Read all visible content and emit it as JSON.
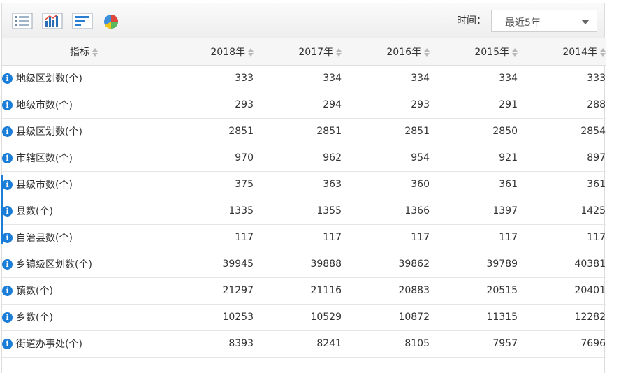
{
  "toolbar": {
    "icons": [
      "table-view-icon",
      "bar-chart-icon",
      "horizontal-bar-chart-icon",
      "pie-chart-icon"
    ],
    "time_label": "时间：",
    "period_selected": "最近5年"
  },
  "table": {
    "indicator_header": "指标",
    "years": [
      "2018年",
      "2017年",
      "2016年",
      "2015年",
      "2014年"
    ],
    "rows": [
      {
        "name": "地级区划数(个)",
        "values": [
          "333",
          "334",
          "334",
          "334",
          "333"
        ]
      },
      {
        "name": "地级市数(个)",
        "values": [
          "293",
          "294",
          "293",
          "291",
          "288"
        ]
      },
      {
        "name": "县级区划数(个)",
        "values": [
          "2851",
          "2851",
          "2851",
          "2850",
          "2854"
        ]
      },
      {
        "name": "市辖区数(个)",
        "values": [
          "970",
          "962",
          "954",
          "921",
          "897"
        ]
      },
      {
        "name": "县级市数(个)",
        "values": [
          "375",
          "363",
          "360",
          "361",
          "361"
        ]
      },
      {
        "name": "县数(个)",
        "values": [
          "1335",
          "1355",
          "1366",
          "1397",
          "1425"
        ]
      },
      {
        "name": "自治县数(个)",
        "values": [
          "117",
          "117",
          "117",
          "117",
          "117"
        ]
      },
      {
        "name": "乡镇级区划数(个)",
        "values": [
          "39945",
          "39888",
          "39862",
          "39789",
          "40381"
        ]
      },
      {
        "name": "镇数(个)",
        "values": [
          "21297",
          "21116",
          "20883",
          "20515",
          "20401"
        ]
      },
      {
        "name": "乡数(个)",
        "values": [
          "10253",
          "10529",
          "10872",
          "11315",
          "12282"
        ]
      },
      {
        "name": "街道办事处(个)",
        "values": [
          "8393",
          "8241",
          "8105",
          "7957",
          "7696"
        ]
      }
    ]
  },
  "colors": {
    "accent": "#1a7dd7",
    "header_bg": "#f6f6f6",
    "border": "#dedede"
  }
}
